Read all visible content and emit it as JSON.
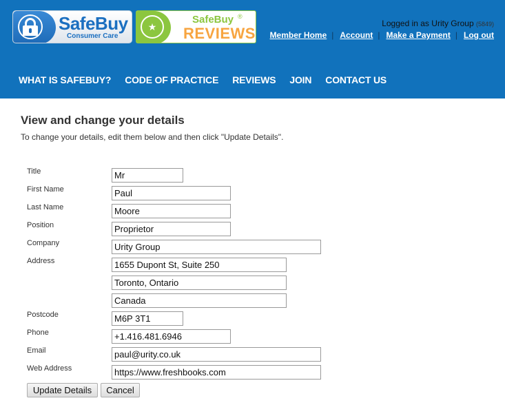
{
  "header": {
    "logo_main": {
      "brand": "SafeBuy",
      "tagline": "Consumer Care",
      "icon": "lock-icon"
    },
    "logo_reviews": {
      "brand": "SafeBuy",
      "registered": "®",
      "subtitle": "REVIEWS",
      "icon": "shooting-star-icon"
    },
    "login": {
      "prefix": "Logged in as",
      "company": "Urity Group",
      "member_id": "(5849)"
    },
    "member_links": [
      {
        "label": "Member Home"
      },
      {
        "label": "Account"
      },
      {
        "label": "Make a Payment"
      },
      {
        "label": "Log out"
      }
    ],
    "separator": "|",
    "nav": [
      {
        "label": "WHAT IS SAFEBUY?"
      },
      {
        "label": "CODE OF PRACTICE"
      },
      {
        "label": "REVIEWS"
      },
      {
        "label": "JOIN"
      },
      {
        "label": "CONTACT US"
      }
    ]
  },
  "main": {
    "title": "View and change your details",
    "intro": "To change your details, edit them below and then click \"Update Details\".",
    "fields": {
      "title": {
        "label": "Title",
        "value": "Mr"
      },
      "first_name": {
        "label": "First Name",
        "value": "Paul"
      },
      "last_name": {
        "label": "Last Name",
        "value": "Moore"
      },
      "position": {
        "label": "Position",
        "value": "Proprietor"
      },
      "company": {
        "label": "Company",
        "value": "Urity Group"
      },
      "address": {
        "label": "Address",
        "lines": [
          "1655 Dupont St, Suite 250",
          "Toronto, Ontario",
          "Canada"
        ]
      },
      "postcode": {
        "label": "Postcode",
        "value": "M6P 3T1"
      },
      "phone": {
        "label": "Phone",
        "value": "+1.416.481.6946"
      },
      "email": {
        "label": "Email",
        "value": "paul@urity.co.uk"
      },
      "web_address": {
        "label": "Web Address",
        "value": "https://www.freshbooks.com"
      }
    },
    "buttons": {
      "update": "Update Details",
      "cancel": "Cancel"
    }
  },
  "colors": {
    "header_bg": "#1172bc",
    "logo_blue": "#1b6fc0",
    "logo_green": "#8cc63f",
    "logo_orange": "#f7a541"
  }
}
